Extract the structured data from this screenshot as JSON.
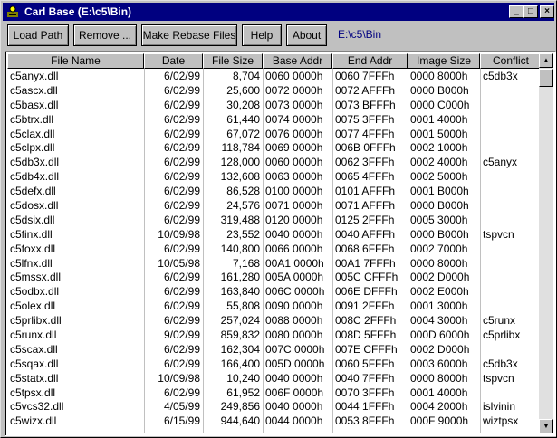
{
  "window": {
    "title": "Carl Base (E:\\c5\\Bin)",
    "minimize_glyph": "_",
    "maximize_glyph": "□",
    "close_glyph": "×"
  },
  "toolbar": {
    "load_path": "Load Path",
    "remove": "Remove ...",
    "make_rebase": "Make Rebase Files",
    "help": "Help",
    "about": "About",
    "path": "E:\\c5\\Bin"
  },
  "table": {
    "columns": [
      "File Name",
      "Date",
      "File Size",
      "Base Addr",
      "End Addr",
      "Image Size",
      "Conflict"
    ],
    "rows": [
      [
        "c5anyx.dll",
        "6/02/99",
        "8,704",
        "0060 0000h",
        "0060 7FFFh",
        "0000 8000h",
        "c5db3x"
      ],
      [
        "c5ascx.dll",
        "6/02/99",
        "25,600",
        "0072 0000h",
        "0072 AFFFh",
        "0000 B000h",
        ""
      ],
      [
        "c5basx.dll",
        "6/02/99",
        "30,208",
        "0073 0000h",
        "0073 BFFFh",
        "0000 C000h",
        ""
      ],
      [
        "c5btrx.dll",
        "6/02/99",
        "61,440",
        "0074 0000h",
        "0075 3FFFh",
        "0001 4000h",
        ""
      ],
      [
        "c5clax.dll",
        "6/02/99",
        "67,072",
        "0076 0000h",
        "0077 4FFFh",
        "0001 5000h",
        ""
      ],
      [
        "c5clpx.dll",
        "6/02/99",
        "118,784",
        "0069 0000h",
        "006B 0FFFh",
        "0002 1000h",
        ""
      ],
      [
        "c5db3x.dll",
        "6/02/99",
        "128,000",
        "0060 0000h",
        "0062 3FFFh",
        "0002 4000h",
        "c5anyx"
      ],
      [
        "c5db4x.dll",
        "6/02/99",
        "132,608",
        "0063 0000h",
        "0065 4FFFh",
        "0002 5000h",
        ""
      ],
      [
        "c5defx.dll",
        "6/02/99",
        "86,528",
        "0100 0000h",
        "0101 AFFFh",
        "0001 B000h",
        ""
      ],
      [
        "c5dosx.dll",
        "6/02/99",
        "24,576",
        "0071 0000h",
        "0071 AFFFh",
        "0000 B000h",
        ""
      ],
      [
        "c5dsix.dll",
        "6/02/99",
        "319,488",
        "0120 0000h",
        "0125 2FFFh",
        "0005 3000h",
        ""
      ],
      [
        "c5finx.dll",
        "10/09/98",
        "23,552",
        "0040 0000h",
        "0040 AFFFh",
        "0000 B000h",
        "tspvcn"
      ],
      [
        "c5foxx.dll",
        "6/02/99",
        "140,800",
        "0066 0000h",
        "0068 6FFFh",
        "0002 7000h",
        ""
      ],
      [
        "c5lfnx.dll",
        "10/05/98",
        "7,168",
        "00A1 0000h",
        "00A1 7FFFh",
        "0000 8000h",
        ""
      ],
      [
        "c5mssx.dll",
        "6/02/99",
        "161,280",
        "005A 0000h",
        "005C CFFFh",
        "0002 D000h",
        ""
      ],
      [
        "c5odbx.dll",
        "6/02/99",
        "163,840",
        "006C 0000h",
        "006E DFFFh",
        "0002 E000h",
        ""
      ],
      [
        "c5olex.dll",
        "6/02/99",
        "55,808",
        "0090 0000h",
        "0091 2FFFh",
        "0001 3000h",
        ""
      ],
      [
        "c5prlibx.dll",
        "6/02/99",
        "257,024",
        "0088 0000h",
        "008C 2FFFh",
        "0004 3000h",
        "c5runx"
      ],
      [
        "c5runx.dll",
        "9/02/99",
        "859,832",
        "0080 0000h",
        "008D 5FFFh",
        "000D 6000h",
        "c5prlibx"
      ],
      [
        "c5scax.dll",
        "6/02/99",
        "162,304",
        "007C 0000h",
        "007E CFFFh",
        "0002 D000h",
        ""
      ],
      [
        "c5sqax.dll",
        "6/02/99",
        "166,400",
        "005D 0000h",
        "0060 5FFFh",
        "0003 6000h",
        "c5db3x"
      ],
      [
        "c5statx.dll",
        "10/09/98",
        "10,240",
        "0040 0000h",
        "0040 7FFFh",
        "0000 8000h",
        "tspvcn"
      ],
      [
        "c5tpsx.dll",
        "6/02/99",
        "61,952",
        "006F 0000h",
        "0070 3FFFh",
        "0001 4000h",
        ""
      ],
      [
        "c5vcs32.dll",
        "4/05/99",
        "249,856",
        "0040 0000h",
        "0044 1FFFh",
        "0004 2000h",
        "islvinin"
      ],
      [
        "c5wizx.dll",
        "6/15/99",
        "944,640",
        "0044 0000h",
        "0053 8FFFh",
        "000F 9000h",
        "wiztpsx"
      ]
    ]
  },
  "scrollbar": {
    "up_glyph": "▲",
    "down_glyph": "▼"
  }
}
